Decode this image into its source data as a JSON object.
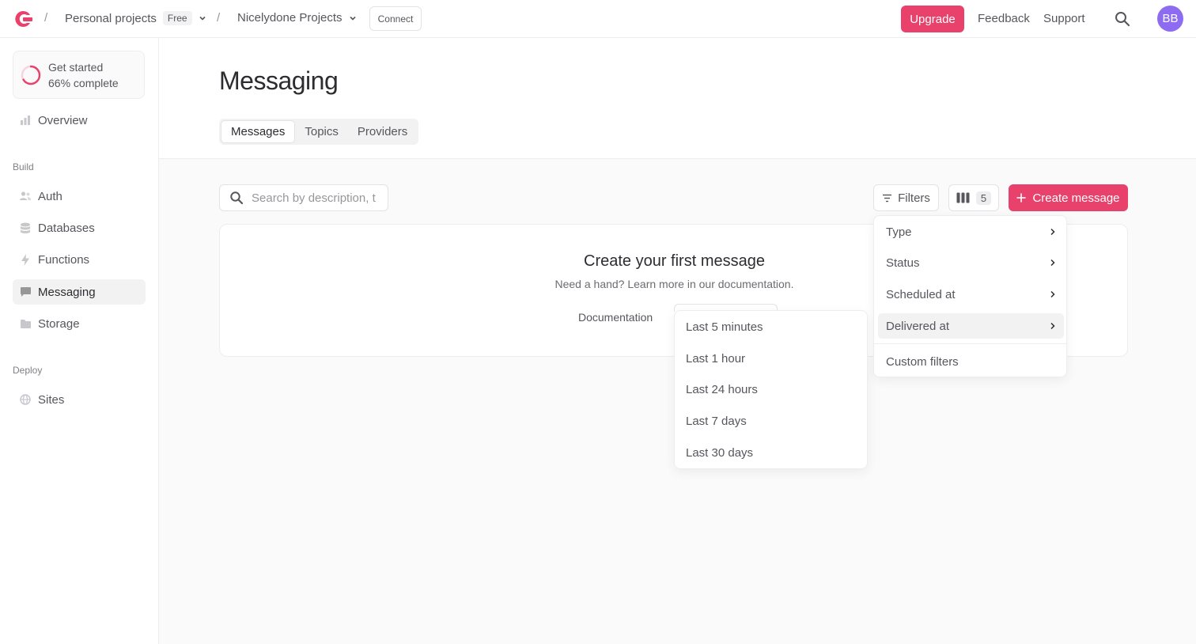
{
  "topbar": {
    "org": "Personal projects",
    "plan_badge": "Free",
    "project": "Nicelydone Projects",
    "connect": "Connect",
    "upgrade": "Upgrade",
    "feedback": "Feedback",
    "support": "Support",
    "avatar": "BB",
    "separator": "/"
  },
  "sidebar": {
    "progress_title": "Get started",
    "progress_status": "66% complete",
    "progress_value": 0.66,
    "overview": "Overview",
    "build_label": "Build",
    "deploy_label": "Deploy",
    "items": {
      "auth": "Auth",
      "databases": "Databases",
      "functions": "Functions",
      "messaging": "Messaging",
      "storage": "Storage",
      "sites": "Sites"
    }
  },
  "page": {
    "title": "Messaging",
    "tabs": [
      "Messages",
      "Topics",
      "Providers"
    ]
  },
  "toolbar": {
    "search_placeholder": "Search by description, t",
    "filters": "Filters",
    "columns_count": "5",
    "create": "Create message"
  },
  "empty": {
    "title": "Create your first message",
    "subtitle": "Need a hand? Learn more in our documentation.",
    "documentation": "Documentation"
  },
  "filters_menu": {
    "items": [
      "Type",
      "Status",
      "Scheduled at",
      "Delivered at"
    ],
    "custom": "Custom filters"
  },
  "delivered_submenu": {
    "items": [
      "Last 5 minutes",
      "Last 1 hour",
      "Last 24 hours",
      "Last 7 days",
      "Last 30 days"
    ]
  },
  "colors": {
    "accent": "#e8416b",
    "avatar": "#8d6cf2"
  }
}
